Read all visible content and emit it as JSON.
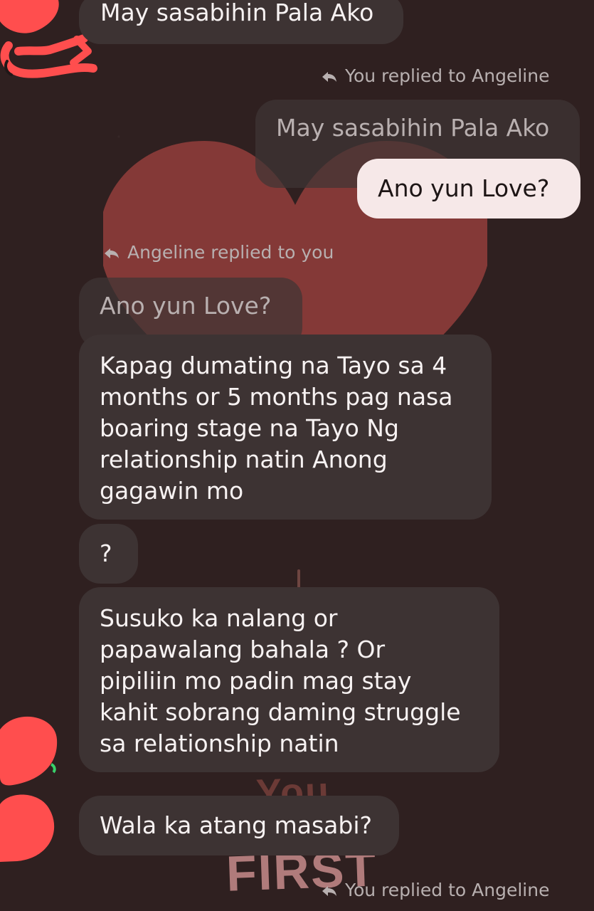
{
  "messages": {
    "top_incoming": "May sasabihin Pala Ako",
    "reply_1_label": "You replied to Angeline",
    "reply_1_quote": "May sasabihin Pala Ako",
    "reply_1_message": "Ano yun Love?",
    "reply_2_label": "Angeline replied to you",
    "reply_2_quote": "Ano yun Love?",
    "message_3_line1": "Kapag dumating na Tayo sa 4",
    "message_3_line2": "months or 5 months pag nasa",
    "message_3_line3": "boaring stage na Tayo Ng",
    "message_3_line4": "relationship natin Anong",
    "message_3_line5": "gagawin mo",
    "message_4": "?",
    "message_5_line1": "Susuko ka nalang or",
    "message_5_line2": "papawalang bahala ? Or",
    "message_5_line3": "pipiliin mo padin mag stay",
    "message_5_line4": "kahit sobrang daming struggle",
    "message_5_line5": "sa relationship natin",
    "message_6": "Wala ka atang masabi?",
    "reply_3_label": "You replied to Angeline"
  },
  "wallpaper": {
    "top_text": "You",
    "bottom_text": "FIRST"
  },
  "colors": {
    "background": "#2f2020",
    "incoming_bubble": "#3d3333",
    "outgoing_bubble": "#f6e8e8",
    "heart": "#8c3c3a",
    "doodle": "#ff4e4e"
  },
  "icons": {
    "reply_arrow": "reply-arrow-icon"
  }
}
